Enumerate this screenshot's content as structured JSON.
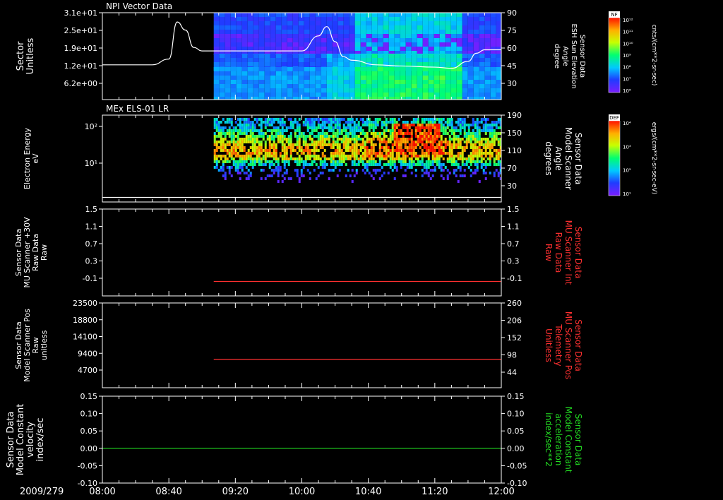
{
  "panels": [
    {
      "id": "npi",
      "title": "NPI Vector Data",
      "type": "spectrogram-with-line",
      "left_label": [
        "Sector",
        "Unitless"
      ],
      "left_ticks": [
        "3.1e+01",
        "2.5e+01",
        "1.9e+01",
        "1.2e+01",
        "6.2e+00"
      ],
      "right_label": [
        "Sensor Data",
        "ESH Sun Elevation",
        "Angle",
        "degree"
      ],
      "right_ticks": [
        "90",
        "75",
        "60",
        "45",
        "30"
      ],
      "right_color": "#ffffff",
      "colorbar": {
        "name": "NF",
        "units": "cnts/(cm**2-sr-sec)",
        "ticks": [
          "10¹²",
          "10¹¹",
          "10¹⁰",
          "10⁹",
          "10⁸",
          "10⁷",
          "10⁶"
        ]
      }
    },
    {
      "id": "els",
      "title": "MEx ELS-01 LR",
      "type": "spectrogram-with-line",
      "left_label": [
        "Electron Energy",
        "eV"
      ],
      "left_ticks": [
        "10²",
        "10¹"
      ],
      "right_label": [
        "Sensor Data",
        "Model Scanner",
        "Angle",
        "degrees"
      ],
      "right_ticks": [
        "190",
        "150",
        "110",
        "70",
        "30"
      ],
      "right_color": "#ffffff",
      "colorbar": {
        "name": "DEF",
        "units": "ergs/(cm**2-sr-sec-eV)",
        "ticks": [
          "10⁴",
          "10³",
          "10²",
          "10¹"
        ]
      }
    },
    {
      "id": "mu_int",
      "title": "",
      "type": "line",
      "left_label": [
        "Sensor Data",
        "MU Scanner +30V",
        "Raw Data",
        "Raw"
      ],
      "left_ticks": [
        "1.5",
        "1.1",
        "0.7",
        "0.3",
        "-0.1"
      ],
      "right_label": [
        "Sensor Data",
        "MU Scanner Int",
        "Raw Data",
        "Raw"
      ],
      "right_ticks": [
        "1.5",
        "1.1",
        "0.7",
        "0.3",
        "-0.1"
      ],
      "right_color": "#ff3030"
    },
    {
      "id": "mu_pos",
      "title": "",
      "type": "line",
      "left_label": [
        "Sensor Data",
        "Model Scanner Pos",
        "Raw",
        "unitless"
      ],
      "left_ticks": [
        "23500",
        "18800",
        "14100",
        "9400",
        "4700"
      ],
      "right_label": [
        "Sensor Data",
        "MU Scanner Pos",
        "Telemetry",
        "Unitless"
      ],
      "right_ticks": [
        "260",
        "206",
        "152",
        "98",
        "44"
      ],
      "right_color": "#ff3030"
    },
    {
      "id": "const",
      "title": "",
      "type": "line",
      "left_label": [
        "Sensor Data",
        "Model Constant",
        "velocity",
        "index/sec"
      ],
      "left_ticks": [
        "0.15",
        "0.10",
        "0.05",
        "0.00",
        "-0.05",
        "-0.10"
      ],
      "right_label": [
        "Sensor Data",
        "Model Constant",
        "acceleration",
        "index/sec**2"
      ],
      "right_ticks": [
        "0.15",
        "0.10",
        "0.05",
        "0.00",
        "-0.05",
        "-0.10"
      ],
      "right_color": "#22dd22"
    }
  ],
  "time_axis": {
    "date_label": "2009/279",
    "ticks": [
      "08:00",
      "08:40",
      "09:20",
      "10:00",
      "10:40",
      "11:20",
      "12:00"
    ]
  },
  "chart_data": [
    {
      "type": "heatmap",
      "title": "NPI Vector Data",
      "ylabel": "Sector Unitless",
      "y2label": "Sensor Data ESH Sun Elevation Angle degree",
      "xlim": [
        "08:00",
        "12:00"
      ],
      "ylim": [
        0,
        31
      ],
      "y2lim": [
        15,
        90
      ],
      "data_start": "09:07",
      "series": [
        {
          "name": "Sensor Data ESH Sun Elevation Angle",
          "color": "#ffffff",
          "x": [
            "08:00",
            "08:30",
            "08:40",
            "08:45",
            "08:50",
            "08:55",
            "09:00",
            "09:40",
            "10:00",
            "10:10",
            "10:15",
            "10:20",
            "10:25",
            "10:30",
            "10:45",
            "11:00",
            "11:20",
            "11:30",
            "11:40",
            "11:45",
            "11:50",
            "12:00"
          ],
          "y": [
            45,
            45,
            50,
            82,
            75,
            60,
            57,
            57,
            57,
            70,
            78,
            65,
            52,
            49,
            45,
            44,
            43,
            42,
            48,
            55,
            58,
            58
          ]
        }
      ]
    },
    {
      "type": "heatmap",
      "title": "MEx ELS-01 LR",
      "ylabel": "Electron Energy eV",
      "y2label": "Sensor Data Model Scanner Angle degrees",
      "xlim": [
        "08:00",
        "12:00"
      ],
      "yscale": "log",
      "y2lim": [
        0,
        190
      ],
      "data_start": "09:07",
      "features": [
        {
          "label": "enhanced flux",
          "x_range": [
            "10:55",
            "11:23"
          ],
          "energy_ev": [
            40,
            130
          ]
        }
      ],
      "series": [
        {
          "name": "Sensor Data Model Scanner Angle",
          "color": "#ffffff",
          "x": [
            "08:00",
            "12:00"
          ],
          "y": [
            10,
            10
          ]
        }
      ]
    },
    {
      "type": "line",
      "ylabel": "Sensor Data MU Scanner +30V Raw Data Raw",
      "y2label": "Sensor Data MU Scanner Int Raw Data Raw",
      "xlim": [
        "08:00",
        "12:00"
      ],
      "ylim": [
        -0.3,
        1.5
      ],
      "series": [
        {
          "name": "Sensor Data MU Scanner Int Raw Data",
          "color": "#ff3030",
          "x": [
            "09:07",
            "12:00"
          ],
          "y": [
            0.0,
            0.0
          ]
        }
      ]
    },
    {
      "type": "line",
      "ylabel": "Sensor Data Model Scanner Pos Raw unitless",
      "y2label": "Sensor Data MU Scanner Pos Telemetry Unitless",
      "xlim": [
        "08:00",
        "12:00"
      ],
      "ylim": [
        0,
        23500
      ],
      "y2lim": [
        17,
        260
      ],
      "series": [
        {
          "name": "Sensor Data MU Scanner Pos Telemetry",
          "color": "#ff3030",
          "x": [
            "09:07",
            "12:00"
          ],
          "y": [
            98,
            98
          ]
        }
      ]
    },
    {
      "type": "line",
      "ylabel": "Sensor Data Model Constant velocity index/sec",
      "y2label": "Sensor Data Model Constant acceleration index/sec**2",
      "xlim": [
        "08:00",
        "12:00"
      ],
      "ylim": [
        -0.1,
        0.15
      ],
      "series": [
        {
          "name": "Sensor Data Model Constant",
          "color": "#22dd22",
          "x": [
            "08:00",
            "12:00"
          ],
          "y": [
            0.0,
            0.0
          ]
        }
      ]
    }
  ]
}
